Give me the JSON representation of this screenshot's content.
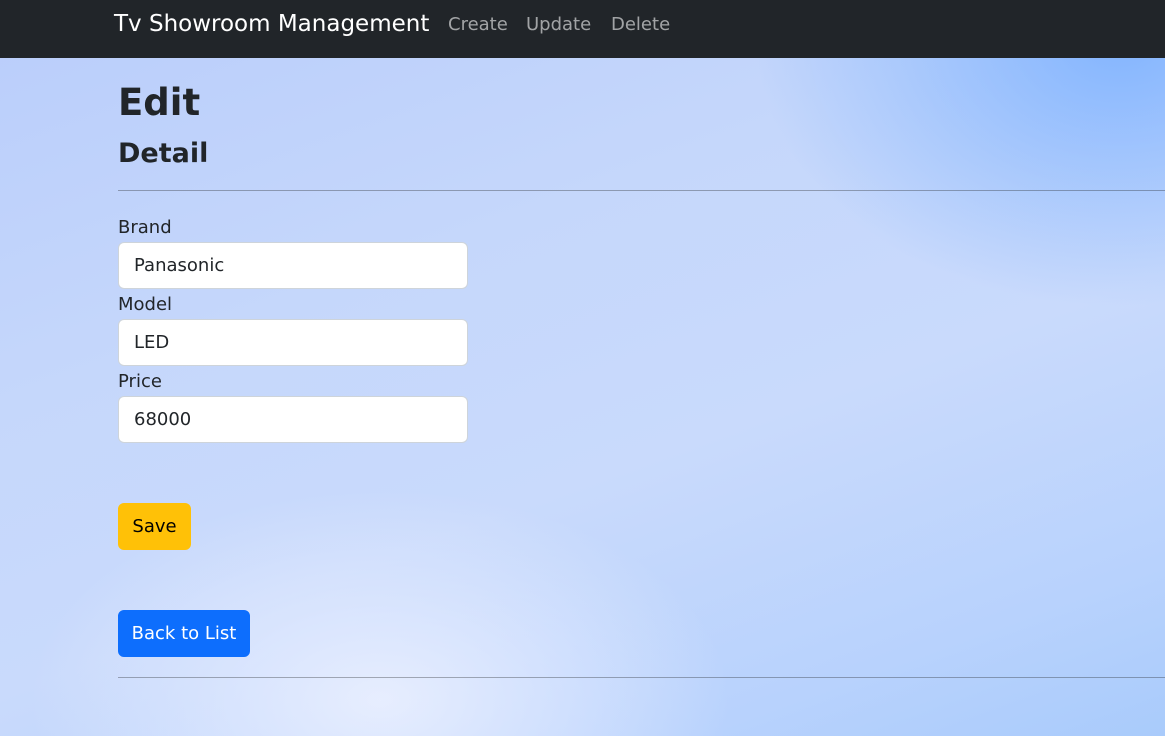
{
  "navbar": {
    "brand": "Tv Showroom Management",
    "links": [
      {
        "label": "Create"
      },
      {
        "label": "Update"
      },
      {
        "label": "Delete"
      }
    ]
  },
  "page": {
    "title": "Edit",
    "subtitle": "Detail"
  },
  "form": {
    "brand": {
      "label": "Brand",
      "value": "Panasonic"
    },
    "model": {
      "label": "Model",
      "value": "LED"
    },
    "price": {
      "label": "Price",
      "value": "68000"
    },
    "save_label": "Save"
  },
  "back_label": "Back to List",
  "colors": {
    "navbar_bg": "#212529",
    "save_button": "#ffc107",
    "back_button": "#0d6efd"
  }
}
